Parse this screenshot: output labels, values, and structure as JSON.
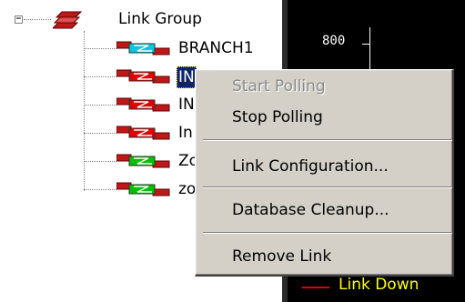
{
  "tree": {
    "expander_glyph": "−",
    "group_label": "Link Group",
    "items": [
      {
        "label": "BRANCH1",
        "status_color": "#00c8e0",
        "selected": false
      },
      {
        "label": "IN",
        "status_color": "#e00000",
        "selected": true
      },
      {
        "label": "IN",
        "status_color": "#e00000",
        "selected": false
      },
      {
        "label": "In",
        "status_color": "#e00000",
        "selected": false
      },
      {
        "label": "Zo",
        "status_color": "#00c000",
        "selected": false
      },
      {
        "label": "zo",
        "status_color": "#00c000",
        "selected": false
      }
    ]
  },
  "graph": {
    "tick_label": "800",
    "legend_label": "Link Down",
    "legend_color": "#e00000"
  },
  "context_menu": {
    "start_polling": "Start Polling",
    "stop_polling": "Stop Polling",
    "link_configuration": "Link Configuration...",
    "database_cleanup": "Database Cleanup...",
    "remove_link": "Remove Link"
  }
}
